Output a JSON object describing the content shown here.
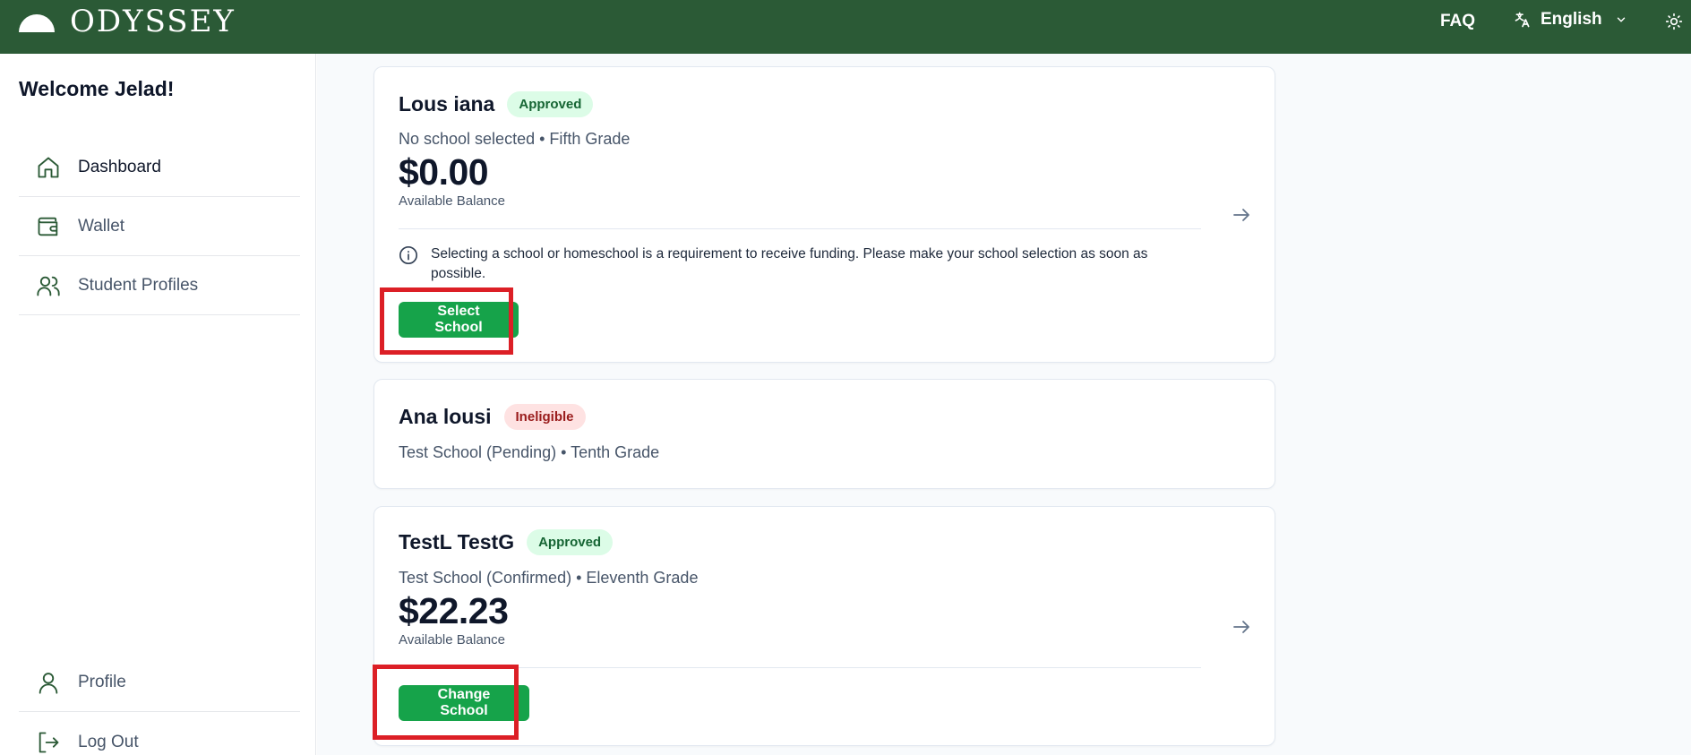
{
  "header": {
    "logo_text": "ODYSSEY",
    "faq_label": "FAQ",
    "language_label": "English",
    "icons": [
      "logo-icon",
      "translate-icon",
      "chevron-down-icon",
      "sun-icon"
    ]
  },
  "sidebar": {
    "welcome": "Welcome Jelad!",
    "items": [
      {
        "label": "Dashboard",
        "icon": "home-icon"
      },
      {
        "label": "Wallet",
        "icon": "wallet-icon"
      },
      {
        "label": "Student Profiles",
        "icon": "users-icon"
      }
    ],
    "bottom_items": [
      {
        "label": "Profile",
        "icon": "user-icon"
      },
      {
        "label": "Log Out",
        "icon": "logout-icon"
      }
    ]
  },
  "students": [
    {
      "name": "Lous iana",
      "status": "Approved",
      "details": "No school selected • Fifth Grade",
      "balance": "$0.00",
      "balance_label": "Available Balance",
      "notice": "Selecting a school or homeschool is a requirement to receive funding. Please make your school selection as soon as possible.",
      "action_label": "Select School"
    },
    {
      "name": "Ana lousi",
      "status": "Ineligible",
      "details": "Test School (Pending) • Tenth Grade"
    },
    {
      "name": "TestL TestG",
      "status": "Approved",
      "details": "Test School (Confirmed) • Eleventh Grade",
      "balance": "$22.23",
      "balance_label": "Available Balance",
      "action_label": "Change School"
    }
  ],
  "colors": {
    "header_bg": "#2b5a36",
    "primary_button": "#16a34a",
    "highlight": "#dc1f26",
    "approved_bg": "#dcfce7",
    "ineligible_bg": "#fee2e2"
  }
}
